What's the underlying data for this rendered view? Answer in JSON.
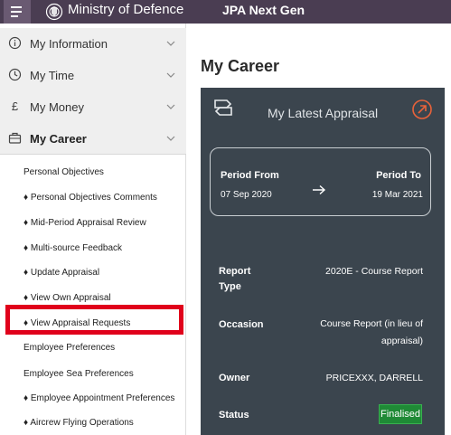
{
  "header": {
    "org_name": "Ministry of Defence",
    "app_name": "JPA Next Gen",
    "menu_icon": "hamburger-icon",
    "crest_icon": "crest-icon"
  },
  "sidebar": {
    "groups": [
      {
        "label": "My Information",
        "icon": "info-icon"
      },
      {
        "label": "My Time",
        "icon": "clock-icon"
      },
      {
        "label": "My Money",
        "icon": "pound-icon"
      },
      {
        "label": "My Career",
        "icon": "briefcase-icon"
      }
    ],
    "career_items": [
      "Personal Objectives",
      "♦ Personal Objectives Comments",
      "♦ Mid-Period Appraisal Review",
      "♦ Multi-source Feedback",
      "♦ Update Appraisal",
      "♦ View Own Appraisal",
      "♦ View Appraisal Requests",
      "Employee Preferences",
      "Employee Sea Preferences",
      "♦ Employee Appointment Preferences",
      "♦ Aircrew Flying Operations"
    ]
  },
  "main": {
    "page_title": "My Career",
    "card": {
      "title": "My Latest Appraisal",
      "period_from_label": "Period From",
      "period_from_value": "07 Sep 2020",
      "period_to_label": "Period To",
      "period_to_value": "19 Mar 2021",
      "report_type_label_1": "Report",
      "report_type_label_2": "Type",
      "report_type_value": "2020E - Course Report",
      "occasion_label": "Occasion",
      "occasion_value_1": "Course Report (in lieu of",
      "occasion_value_2": "appraisal)",
      "owner_label": "Owner",
      "owner_value": "PRICEXXX, DARRELL",
      "status_label": "Status",
      "status_value": "Finalised"
    }
  },
  "colors": {
    "topbar": "#4a3d52",
    "card_bg": "#3b454e",
    "accent_orange": "#e8623a",
    "highlight_red": "#e0001b",
    "status_green": "#1f8a36"
  }
}
